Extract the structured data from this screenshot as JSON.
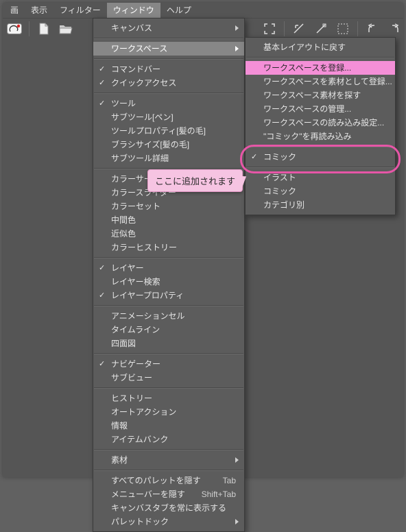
{
  "menubar": {
    "items": [
      {
        "label": "画"
      },
      {
        "label": "表示"
      },
      {
        "label": "フィルター"
      },
      {
        "label": "ウィンドウ",
        "active": true
      },
      {
        "label": "ヘルプ"
      }
    ]
  },
  "window_menu": {
    "groups": [
      [
        {
          "label": "キャンバス",
          "submenu": true
        }
      ],
      [
        {
          "label": "ワークスペース",
          "submenu": true,
          "highlight": true
        }
      ],
      [
        {
          "label": "コマンドバー",
          "checked": true
        },
        {
          "label": "クイックアクセス",
          "checked": true
        }
      ],
      [
        {
          "label": "ツール",
          "checked": true
        },
        {
          "label": "サブツール[ペン]"
        },
        {
          "label": "ツールプロパティ[髪の毛]"
        },
        {
          "label": "ブラシサイズ[髪の毛]"
        },
        {
          "label": "サブツール詳細"
        }
      ],
      [
        {
          "label": "カラーサークル"
        },
        {
          "label": "カラースライダー"
        },
        {
          "label": "カラーセット"
        },
        {
          "label": "中間色"
        },
        {
          "label": "近似色"
        },
        {
          "label": "カラーヒストリー"
        }
      ],
      [
        {
          "label": "レイヤー",
          "checked": true
        },
        {
          "label": "レイヤー検索"
        },
        {
          "label": "レイヤープロパティ",
          "checked": true
        }
      ],
      [
        {
          "label": "アニメーションセル"
        },
        {
          "label": "タイムライン"
        },
        {
          "label": "四面図"
        }
      ],
      [
        {
          "label": "ナビゲーター",
          "checked": true
        },
        {
          "label": "サブビュー"
        }
      ],
      [
        {
          "label": "ヒストリー"
        },
        {
          "label": "オートアクション"
        },
        {
          "label": "情報"
        },
        {
          "label": "アイテムバンク"
        }
      ],
      [
        {
          "label": "素材",
          "submenu": true
        }
      ],
      [
        {
          "label": "すべてのパレットを隠す",
          "shortcut": "Tab"
        },
        {
          "label": "メニューバーを隠す",
          "shortcut": "Shift+Tab"
        },
        {
          "label": "キャンバスタブを常に表示する"
        },
        {
          "label": "パレットドック",
          "submenu": true
        }
      ]
    ]
  },
  "workspace_submenu": {
    "groups": [
      [
        {
          "label": "基本レイアウトに戻す"
        }
      ],
      [
        {
          "label": "ワークスペースを登録...",
          "pink": true
        },
        {
          "label": "ワークスペースを素材として登録..."
        },
        {
          "label": "ワークスペース素材を探す"
        },
        {
          "label": "ワークスペースの管理..."
        },
        {
          "label": "ワークスペースの読み込み設定..."
        },
        {
          "label": "\"コミック\"を再読み込み"
        }
      ],
      [
        {
          "label": "コミック",
          "checked": true,
          "ring": true
        }
      ],
      [
        {
          "label": "イラスト"
        },
        {
          "label": "コミック"
        },
        {
          "label": "カテゴリ別"
        }
      ]
    ]
  },
  "callout": {
    "text": "ここに追加されます"
  }
}
